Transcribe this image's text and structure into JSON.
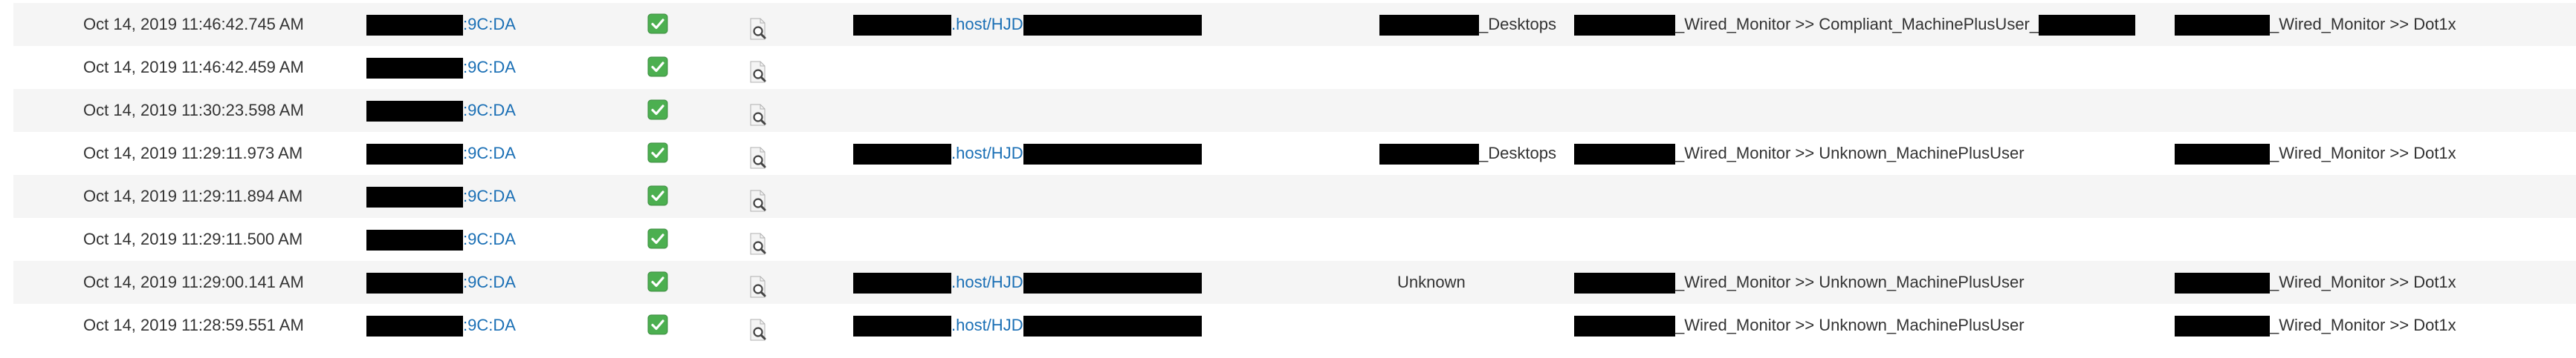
{
  "icons": {
    "status": "green-checkmark-icon",
    "details": "magnifier-details-icon"
  },
  "colors": {
    "link": "#1a6fb5",
    "status_green": "#4caf50",
    "row_alt": "#f5f5f5",
    "redaction": "#000000"
  },
  "rows": [
    {
      "timestamp": "Oct 14, 2019 11:46:42.745 AM",
      "mac_suffix": ":9C:DA",
      "endpoint_mid": ".host/HJD",
      "identity_group": "_Desktops",
      "authz_policy": "_Wired_Monitor >> Compliant_MachinePlusUser_",
      "authz_policy_tail_redacted": true,
      "auth_policy": "_Wired_Monitor >> Dot1x"
    },
    {
      "timestamp": "Oct 14, 2019 11:46:42.459 AM",
      "mac_suffix": ":9C:DA"
    },
    {
      "timestamp": "Oct 14, 2019 11:30:23.598 AM",
      "mac_suffix": ":9C:DA"
    },
    {
      "timestamp": "Oct 14, 2019 11:29:11.973 AM",
      "mac_suffix": ":9C:DA",
      "endpoint_mid": ".host/HJD",
      "identity_group": "_Desktops",
      "authz_policy": "_Wired_Monitor >> Unknown_MachinePlusUser",
      "auth_policy": "_Wired_Monitor >> Dot1x"
    },
    {
      "timestamp": "Oct 14, 2019 11:29:11.894 AM",
      "mac_suffix": ":9C:DA"
    },
    {
      "timestamp": "Oct 14, 2019 11:29:11.500 AM",
      "mac_suffix": ":9C:DA"
    },
    {
      "timestamp": "Oct 14, 2019 11:29:00.141 AM",
      "mac_suffix": ":9C:DA",
      "endpoint_mid": ".host/HJD",
      "identity_group_plain": "Unknown",
      "authz_policy": "_Wired_Monitor >> Unknown_MachinePlusUser",
      "auth_policy": "_Wired_Monitor >> Dot1x"
    },
    {
      "timestamp": "Oct 14, 2019 11:28:59.551 AM",
      "mac_suffix": ":9C:DA",
      "endpoint_mid": ".host/HJD",
      "authz_policy": "_Wired_Monitor >> Unknown_MachinePlusUser",
      "auth_policy": "_Wired_Monitor >> Dot1x"
    }
  ]
}
